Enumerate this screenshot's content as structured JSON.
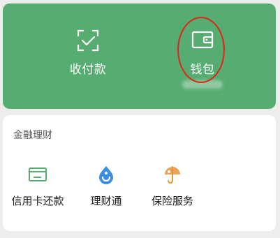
{
  "top": {
    "receive_pay": {
      "label": "收付款",
      "icon": "scan-check-icon"
    },
    "wallet": {
      "label": "钱包",
      "icon": "wallet-icon"
    },
    "highlight_color": "#e0241a"
  },
  "finance": {
    "title": "金融理财",
    "services": [
      {
        "label": "信用卡还款",
        "icon": "credit-card-icon",
        "color": "#57ad71"
      },
      {
        "label": "理财通",
        "icon": "wealth-drop-icon",
        "color": "#3b8fdc"
      },
      {
        "label": "保险服务",
        "icon": "umbrella-icon",
        "color": "#e8923a"
      }
    ]
  },
  "colors": {
    "green": "#57ad71",
    "background": "#ededed",
    "card": "#ffffff"
  }
}
